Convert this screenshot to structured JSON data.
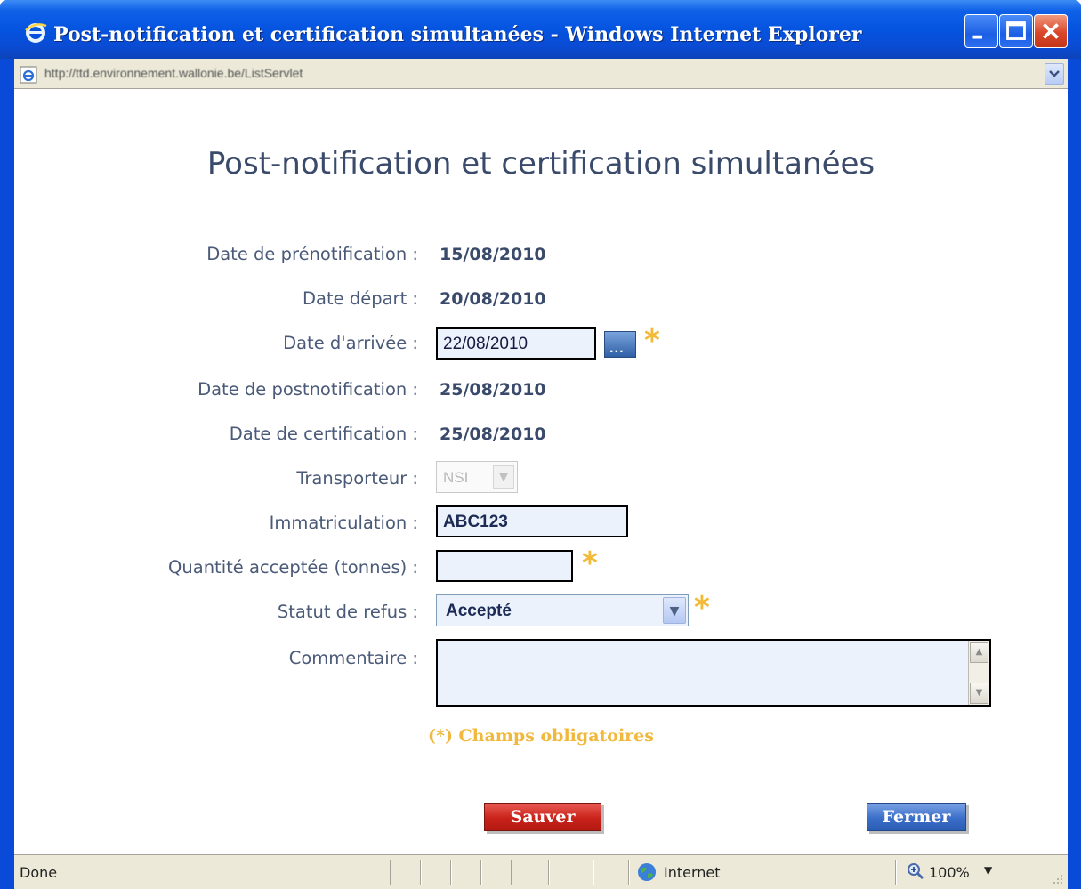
{
  "window": {
    "title": "Post-notification et certification simultanées - Windows Internet Explorer",
    "address_url": "http://ttd.environnement.wallonie.be/ListServlet"
  },
  "page": {
    "title": "Post-notification et certification simultanées",
    "fields": {
      "prenotification": {
        "label": "Date de prénotification :",
        "value": "15/08/2010"
      },
      "depart": {
        "label": "Date départ :",
        "value": "20/08/2010"
      },
      "arrivee": {
        "label": "Date d'arrivée :",
        "value": "22/08/2010",
        "required": true
      },
      "postnotification": {
        "label": "Date de postnotification :",
        "value": "25/08/2010"
      },
      "certification": {
        "label": "Date de certification :",
        "value": "25/08/2010"
      },
      "transporteur": {
        "label": "Transporteur :",
        "value": "NSI",
        "disabled": true
      },
      "immatriculation": {
        "label": "Immatriculation :",
        "value": "ABC123"
      },
      "quantite": {
        "label": "Quantité acceptée (tonnes) :",
        "value": "",
        "required": true
      },
      "statut": {
        "label": "Statut de refus :",
        "value": "Accepté",
        "required": true
      },
      "commentaire": {
        "label": "Commentaire :",
        "value": ""
      }
    },
    "calendar_button": "...",
    "required_marker": "*",
    "required_note": "(*) Champs obligatoires",
    "save_label": "Sauver",
    "close_label": "Fermer"
  },
  "statusbar": {
    "status": "Done",
    "zone": "Internet",
    "zoom": "100%"
  },
  "colors": {
    "title_blue": "#0554e0",
    "label": "#4a5a78",
    "value": "#3a4a6b",
    "required_star": "#f3ba37",
    "save_button": "#c9221a",
    "close_button": "#3a6ec9",
    "field_bg": "#ebf2fc"
  }
}
